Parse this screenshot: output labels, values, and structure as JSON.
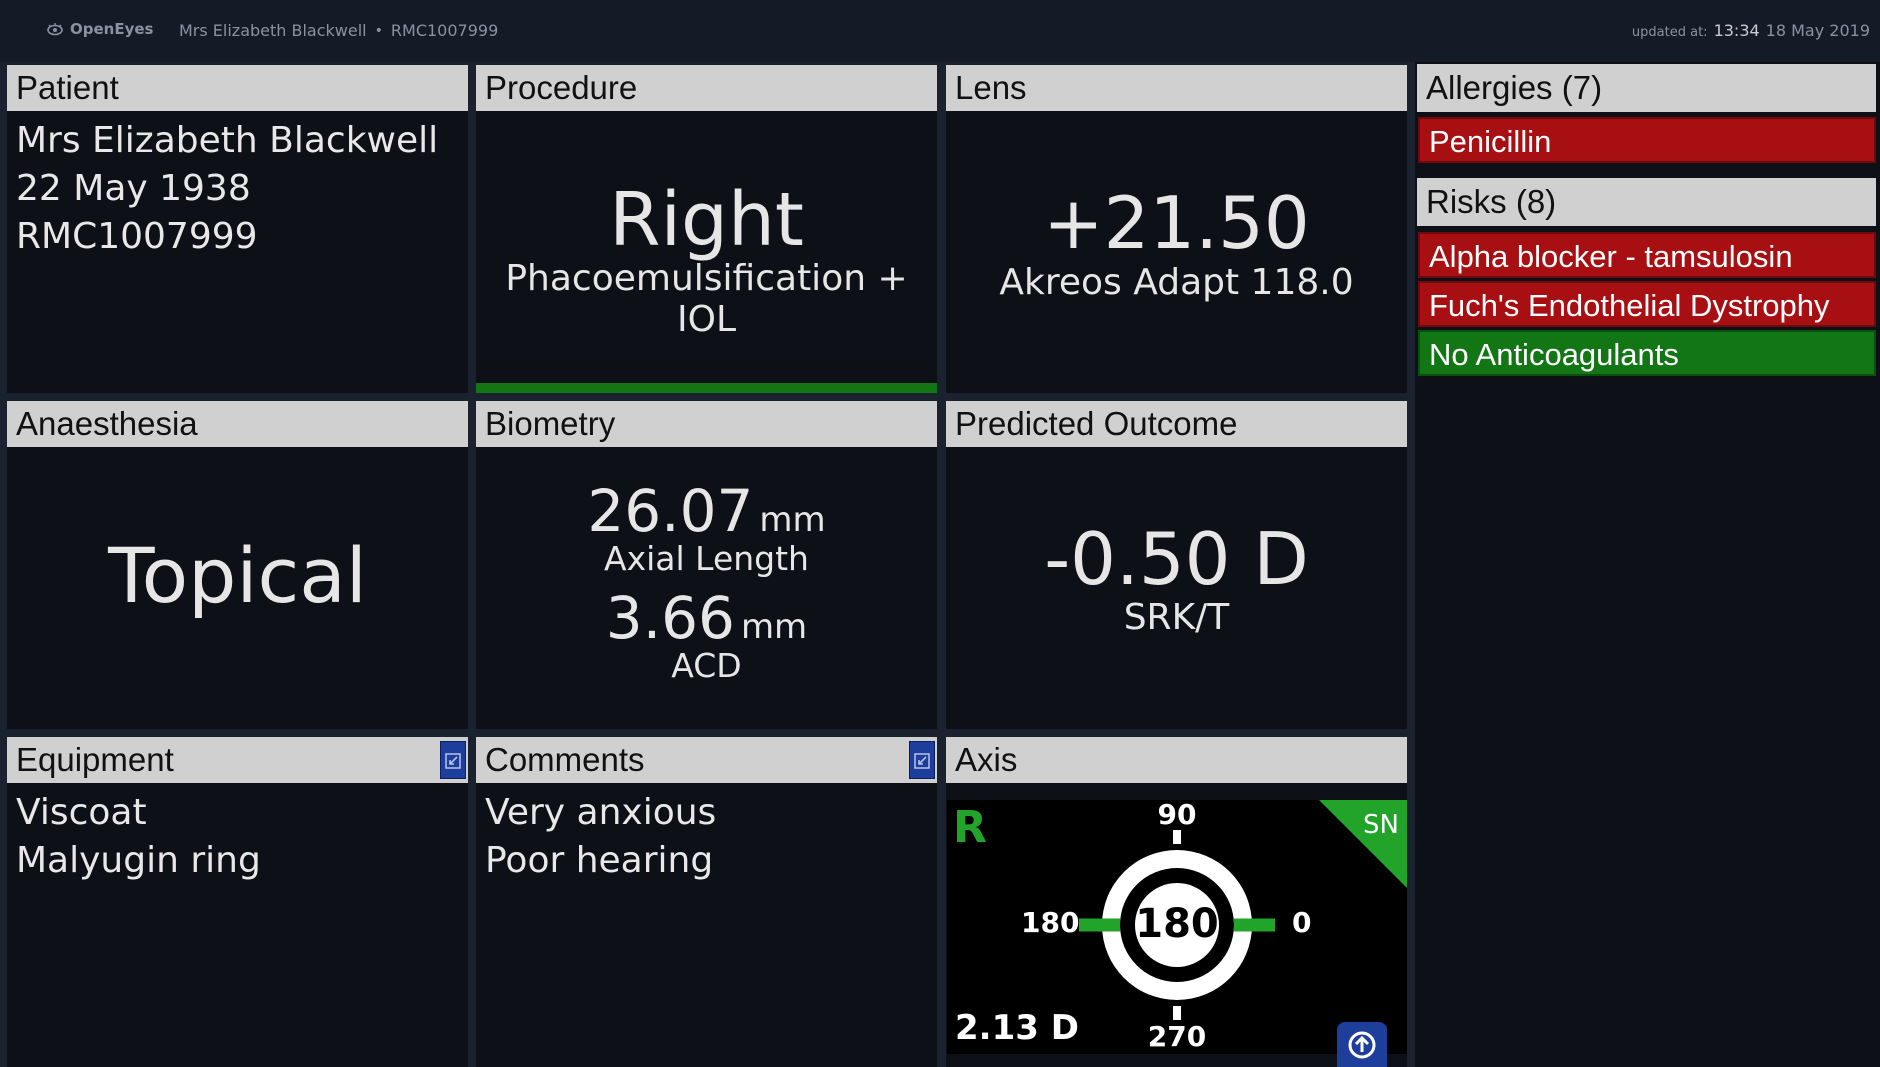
{
  "app": {
    "logo": "OpenEyes"
  },
  "header": {
    "patient_name": "Mrs Elizabeth Blackwell",
    "patient_id": "RMC1007999",
    "updated_label": "updated at:",
    "updated_time": "13:34",
    "updated_date": "18 May 2019"
  },
  "patient": {
    "title": "Patient",
    "name": "Mrs Elizabeth Blackwell",
    "dob": "22 May 1938",
    "id": "RMC1007999"
  },
  "procedure": {
    "title": "Procedure",
    "side": "Right",
    "name": "Phacoemulsification + IOL"
  },
  "lens": {
    "title": "Lens",
    "power": "+21.50",
    "model": "Akreos Adapt 118.0"
  },
  "anaesthesia": {
    "title": "Anaesthesia",
    "type": "Topical"
  },
  "biometry": {
    "title": "Biometry",
    "axial_value": "26.07",
    "axial_unit": "mm",
    "axial_label": "Axial Length",
    "acd_value": "3.66",
    "acd_unit": "mm",
    "acd_label": "ACD"
  },
  "outcome": {
    "title": "Predicted Outcome",
    "value": "-0.50 D",
    "formula": "SRK/T"
  },
  "equipment": {
    "title": "Equipment",
    "items": [
      "Viscoat",
      "Malyugin ring"
    ]
  },
  "comments": {
    "title": "Comments",
    "items": [
      "Very anxious",
      "Poor hearing"
    ]
  },
  "axis": {
    "title": "Axis",
    "eye": "R",
    "corner": "SN",
    "top": "90",
    "bottom": "270",
    "left": "180",
    "right": "0",
    "center": "180",
    "power": "2.13 D"
  },
  "allergies": {
    "title": "Allergies (7)",
    "items": [
      "Penicillin"
    ]
  },
  "risks": {
    "title": "Risks (8)",
    "items": [
      "Alpha blocker - tamsulosin",
      "Fuch's Endothelial Dystrophy",
      "No Anticoagulants"
    ]
  },
  "colors": {
    "red": "#a80f12",
    "green": "#137615",
    "header": "#d0d0d0",
    "panel": "#0e1018",
    "accent": "#1d3e9a"
  }
}
